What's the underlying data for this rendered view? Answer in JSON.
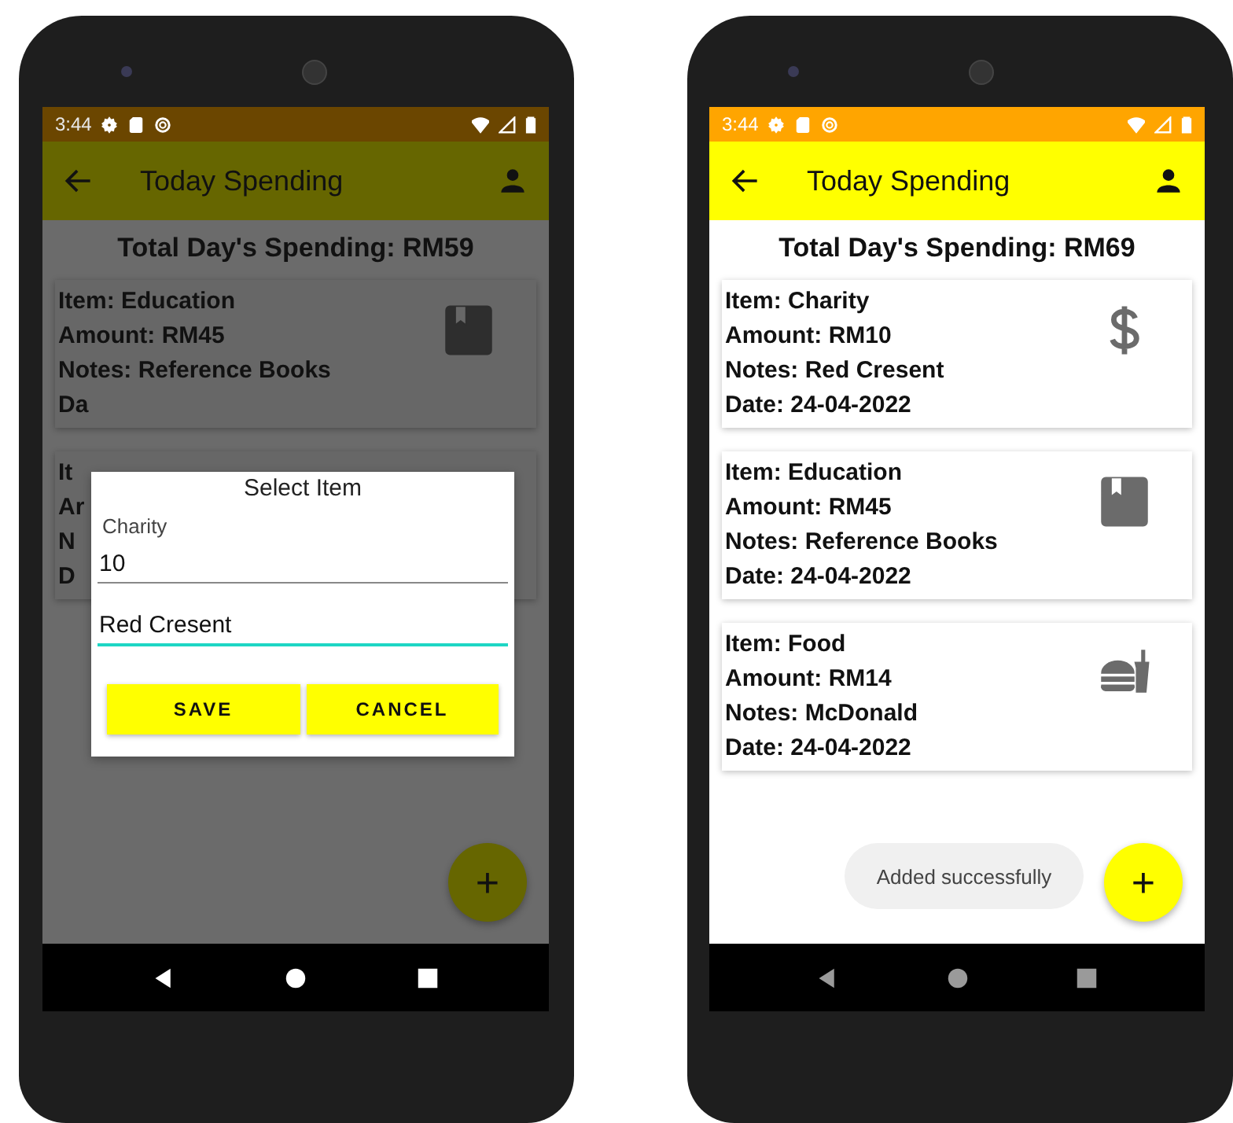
{
  "phones": [
    {
      "status_time": "3:44",
      "title": "Today Spending",
      "total": "Total Day's Spending: RM59",
      "dimmed": true,
      "cards": [
        {
          "kind": "book",
          "lines": [
            "Item: Education",
            "Amount: RM45",
            "Notes: Reference Books",
            "Da"
          ]
        },
        {
          "lines": [
            "It",
            "Ar",
            "N",
            "D"
          ]
        }
      ],
      "dialog": {
        "title": "Select Item",
        "label": "Charity",
        "fields": [
          {
            "value": "10",
            "focused": false
          },
          {
            "value": "Red Cresent",
            "focused": true
          }
        ],
        "buttons": [
          "SAVE",
          "CANCEL"
        ]
      },
      "fab": "+"
    },
    {
      "status_time": "3:44",
      "title": "Today Spending",
      "total": "Total Day's Spending: RM69",
      "dimmed": false,
      "cards": [
        {
          "kind": "dollar",
          "lines": [
            "Item: Charity",
            "Amount: RM10",
            "Notes: Red Cresent",
            "Date: 24-04-2022"
          ]
        },
        {
          "kind": "book",
          "lines": [
            "Item: Education",
            "Amount: RM45",
            "Notes: Reference Books",
            "Date: 24-04-2022"
          ]
        },
        {
          "kind": "food",
          "lines": [
            "Item: Food",
            "Amount: RM14",
            "Notes: McDonald",
            "Date: 24-04-2022"
          ]
        }
      ],
      "toast": "Added successfully",
      "fab": "+"
    }
  ]
}
